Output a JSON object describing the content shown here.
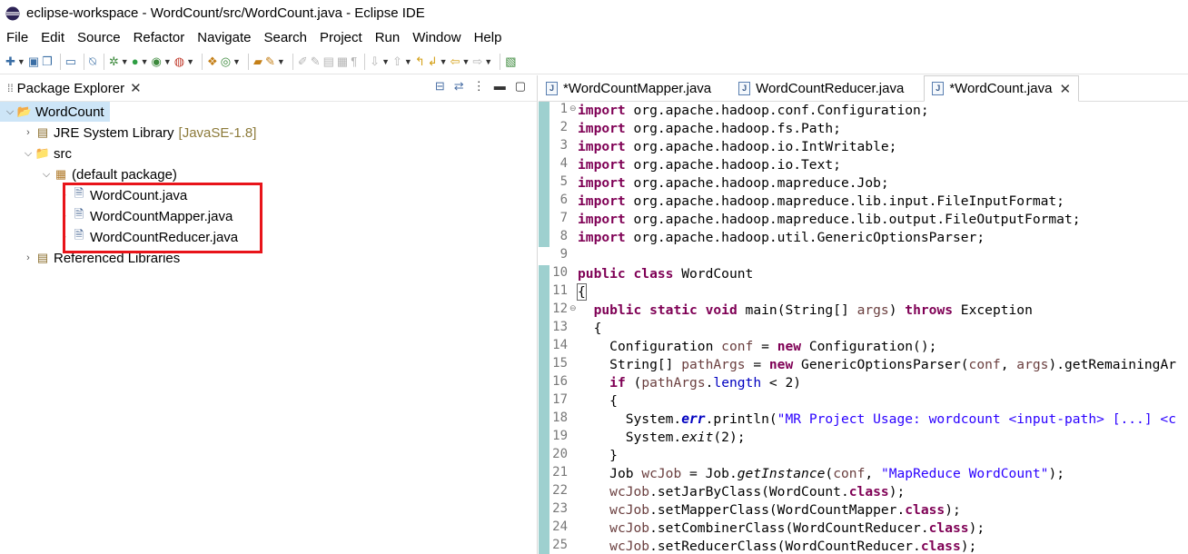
{
  "window": {
    "title": "eclipse-workspace - WordCount/src/WordCount.java - Eclipse IDE"
  },
  "menu": [
    "File",
    "Edit",
    "Source",
    "Refactor",
    "Navigate",
    "Search",
    "Project",
    "Run",
    "Window",
    "Help"
  ],
  "package_explorer": {
    "title": "Package Explorer",
    "project": "WordCount",
    "jre": "JRE System Library",
    "jre_decoration": "[JavaSE-1.8]",
    "src": "src",
    "package": "(default package)",
    "files": [
      "WordCount.java",
      "WordCountMapper.java",
      "WordCountReducer.java"
    ],
    "referenced": "Referenced Libraries"
  },
  "editor": {
    "tabs": [
      "*WordCountMapper.java",
      "WordCountReducer.java",
      "*WordCount.java"
    ],
    "line_numbers": [
      "1",
      "2",
      "3",
      "4",
      "5",
      "6",
      "7",
      "8",
      "9",
      "10",
      "11",
      "12",
      "13",
      "14",
      "15",
      "16",
      "17",
      "18",
      "19",
      "20",
      "21",
      "22",
      "23",
      "24",
      "25"
    ],
    "imports": [
      "org.apache.hadoop.conf.Configuration;",
      "org.apache.hadoop.fs.Path;",
      "org.apache.hadoop.io.IntWritable;",
      "org.apache.hadoop.io.Text;",
      "org.apache.hadoop.mapreduce.Job;",
      "org.apache.hadoop.mapreduce.lib.input.FileInputFormat;",
      "org.apache.hadoop.mapreduce.lib.output.FileOutputFormat;",
      "org.apache.hadoop.util.GenericOptionsParser;"
    ],
    "kw_import": "import",
    "kw_public": "public",
    "kw_class": "class",
    "kw_static": "static",
    "kw_void": "void",
    "kw_throws": "throws",
    "kw_new": "new",
    "kw_if": "if",
    "class_name": " WordCount",
    "brace_open": "{",
    "brace_close": "}",
    "main_sig": " main(String[] ",
    "args": "args",
    "main_close": ") ",
    "exception": " Exception",
    "l14_a": "Configuration ",
    "conf": "conf",
    "l14_b": " = ",
    "l14_c": " Configuration();",
    "l15_a": "String[] ",
    "pathArgs": "pathArgs",
    "l15_c": " GenericOptionsParser(",
    "l15_d": ", ",
    "l15_e": ").getRemainingAr",
    "l16_a": " (",
    "length": "length",
    "l16_b": " < 2)",
    "sys": "System.",
    "err": "err",
    "println": ".println(",
    "usage_str": "\"MR Project Usage: wordcount <input-path> [...] <c",
    "exit": "exit",
    "exit_arg": "(2);",
    "l21_a": "Job ",
    "wcJob": "wcJob",
    "l21_b": " = Job.",
    "getInstance": "getInstance",
    "l21_c": "(",
    "l21_d": ", ",
    "mr_str": "\"MapReduce WordCount\"",
    "l21_e": ");",
    "l22": ".setJarByClass(WordCount.",
    "l23": ".setMapperClass(WordCountMapper.",
    "l24": ".setCombinerClass(WordCountReducer.",
    "l25": ".setReducerClass(WordCountReducer.",
    "cls_end": ");"
  }
}
